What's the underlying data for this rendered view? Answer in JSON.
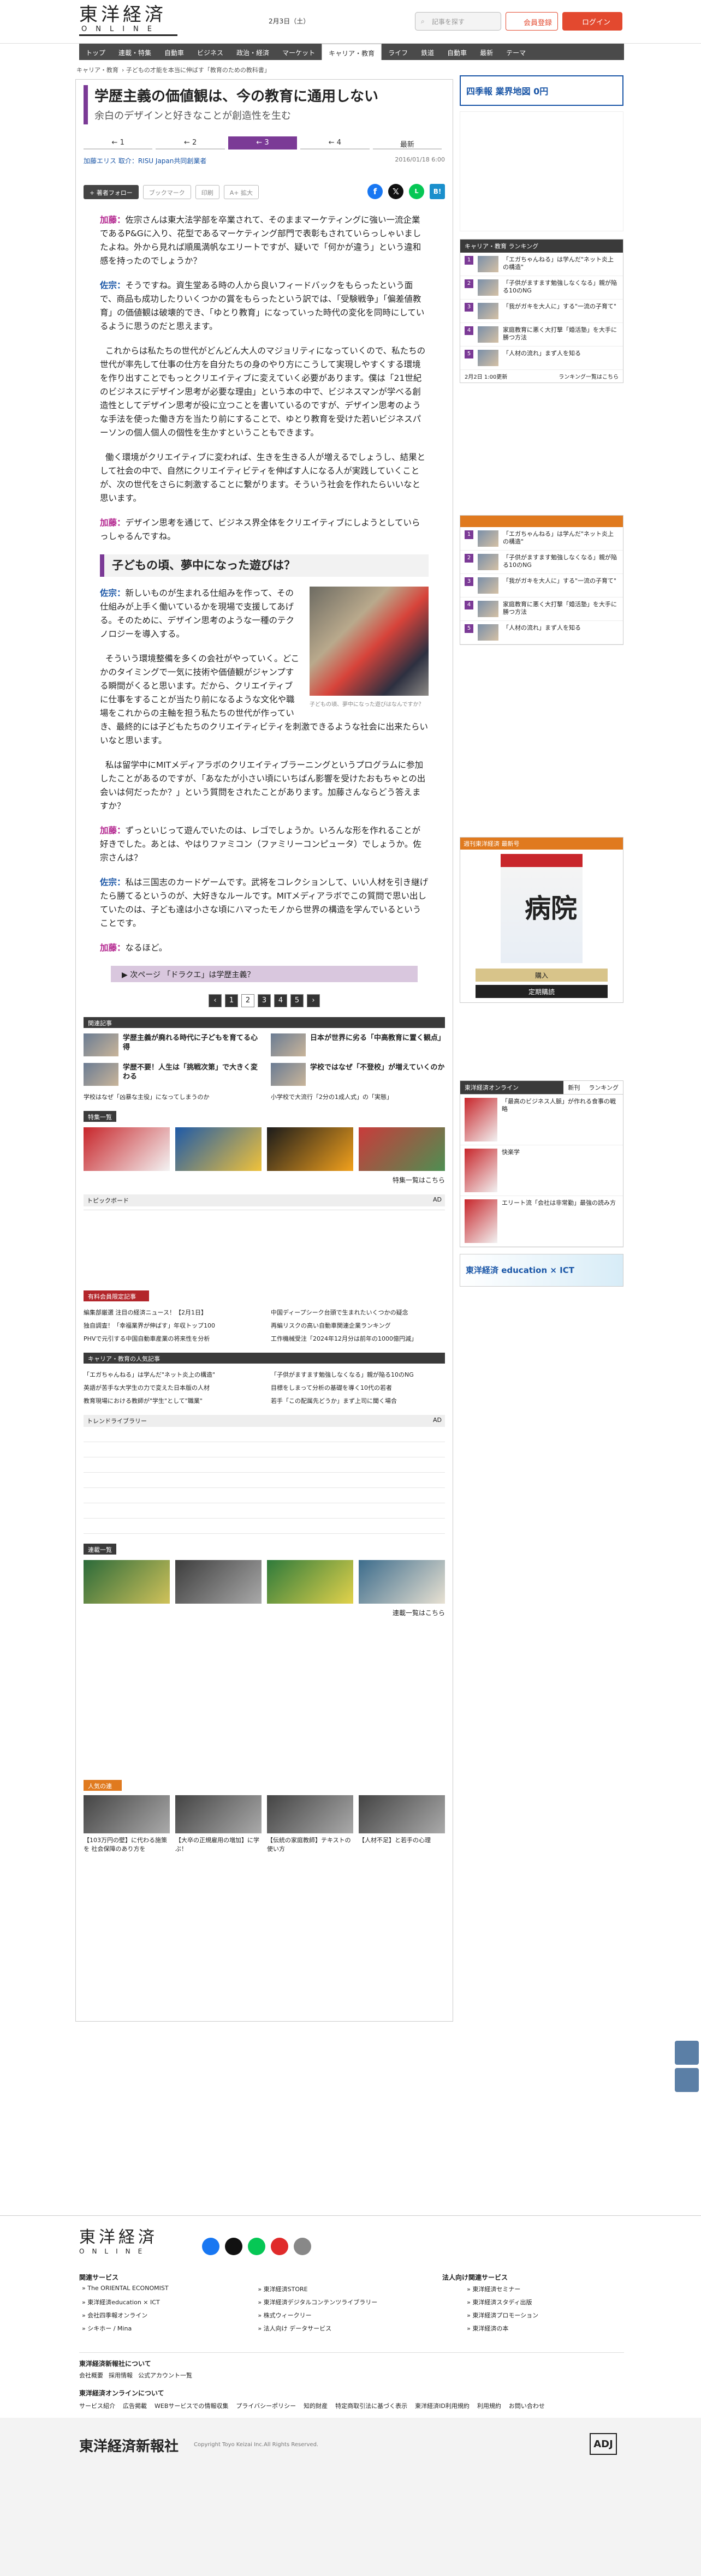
{
  "header": {
    "logo_jp": "東洋経済",
    "logo_en": "ONLINE",
    "date": "2月3日（土）",
    "search_placeholder": "記事を探す",
    "register": "会員登録",
    "login": "ログイン"
  },
  "nav": [
    "トップ",
    "連載・特集",
    "自動車",
    "ビジネス",
    "政治・経済",
    "マーケット",
    "キャリア・教育",
    "ライフ",
    "鉄道",
    "自動車",
    "最新",
    "テーマ"
  ],
  "nav_active": 6,
  "breadcrumb": [
    "キャリア・教育",
    "子どもの才能を本当に伸ばす「教育のための教科書」"
  ],
  "article": {
    "title": "学歴主義の価値観は、今の教育に通用しない",
    "subtitle": "余白のデザインと好きなことが創造性を生む",
    "page_tabs": [
      "1",
      "2",
      "3",
      "4",
      "最新"
    ],
    "current_page": 2,
    "author": "加藤エリス 取介：RISU Japan共同創業者",
    "date": "2016/01/18 6:00",
    "follow": "著者フォロー",
    "bookmark": "ブックマーク",
    "print": "印刷",
    "font": "A+ 拡大",
    "p1_speaker": "加藤：",
    "p1": "佐宗さんは東大法学部を卒業されて、そのままマーケティングに強い一流企業であるP&Gに入り、花型であるマーケティング部門で表彰もされていらっしゃいましたよね。外から見れば順風満帆なエリートですが、疑いで「何かが違う」という違和感を持ったのでしょうか？",
    "p2_speaker": "佐宗：",
    "p2": "そうですね。資生堂ある時の人から良いフィードバックをもらったという面で、商品も成功したりいくつかの賞をもらったという訳では、「受験戦争」「偏差値教育」の価値観は破壊的でき、「ゆとり教育」になっていった時代の変化を同時にしているように思うのだと思えます。",
    "p3": "これからは私たちの世代がどんどん大人のマジョリティになっていくので、私たちの世代が率先して仕事の仕方を自分たちの身のやり方にこうして実現しやすくする環境を作り出すことでもっとクリエイティブに変えていく必要があります。僕は「21世紀のビジネスにデザイン思考が必要な理由」という本の中で、ビジネスマンが学べる創造性としてデザイン思考が役に立つことを書いているのですが、デザイン思考のような手法を使った働き方を当たり前にすることで、ゆとり教育を受けた若いビジネスパーソンの個人個人の個性を生かすということもできます。",
    "p4": "働く環境がクリエイティブに変われば、生きを生きる人が増えるでしょうし、結果として社会の中で、自然にクリエイティビティを伸ばす人になる人が実践していくことが、次の世代をさらに刺激することに繋がります。そういう社会を作れたらいいなと思います。",
    "p5_speaker": "加藤：",
    "p5": "デザイン思考を通じて、ビジネス界全体をクリエイティブにしようとしていらっしゃるんですね。",
    "subhead": "子どもの頃、夢中になった遊びは？",
    "p6_speaker": "佐宗：",
    "p6": "新しいものが生まれる仕組みを作って、その仕組みが上手く働いているかを現場で支援してあげる。そのために、デザイン思考のような一種のテクノロジーを導入する。",
    "photo_caption": "子どもの頃、夢中になった遊びはなんですか？",
    "p7": "そういう環境整備を多くの会社がやっていく。どこかのタイミングで一気に技術や価値観がジャンプする瞬間がくると思います。だから、クリエイティブに仕事をすることが当たり前になるような文化や職場をこれからの主軸を担う私たちの世代が作っていき、最終的には子どもたちのクリエイティビティを刺激できるような社会に出来たらいいなと思います。",
    "p8": "私は留学中にMITメディアラボのクリエイティブラーニングというプログラムに参加したことがあるのですが、「あなたが小さい頃にいちばん影響を受けたおもちゃとの出会いは何だったか？」という質問をされたことがあります。加藤さんならどう答えますか？",
    "p9_speaker": "加藤：",
    "p9": "ずっといじって遊んでいたのは、レゴでしょうか。いろんな形を作れることが好きでした。あとは、やはりファミコン（ファミリーコンピュータ）でしょうか。佐宗さんは？",
    "p10_speaker": "佐宗：",
    "p10": "私は三国志のカードゲームです。武将をコレクションして、いい人材を引き継げたら勝てるというのが、大好きなルールです。MITメディアラボでこの質問で思い出していたのは、子ども達は小さな頃にハマったモノから世界の構造を学んでいるということです。",
    "p11_speaker": "加藤：",
    "p11": "なるほど。",
    "next": "次ページ 「ドラクエ」は学歴主義？",
    "pager": [
      "1",
      "2",
      "3",
      "4",
      "5"
    ]
  },
  "related": {
    "label": "関連記事",
    "items": [
      "学歴主義が廃れる時代に子どもを育てる心得",
      "日本が世界に劣る「中高教育に置く観点」",
      "学歴不要！人生は「挑戦次第」で大きく変わる",
      "学校ではなぜ「不登校」が増えていくのか"
    ],
    "small": [
      "学校はなぜ「凶暴な主役」になってしまうのか",
      "小学校で大流行「2分の1成人式」の「実態」"
    ]
  },
  "feature": {
    "label": "特集一覧",
    "more": "特集一覧はこちら"
  },
  "topic": {
    "label": "トピックボード",
    "ad": "AD"
  },
  "paid": {
    "label": "有料会員限定記事",
    "items": [
      "編集部厳選 注目の経済ニュース！【2月1日】",
      "中国ディープシーク台頭で生まれたいくつかの疑念",
      "独自調査！「幸福業界が伸ばす」年収トップ100",
      "再編リスクの高い自動車関連企業ランキング",
      "PHVで元引する中国自動車産業の将来性を分析",
      "工作機械受注「2024年12月分は前年の1000億円減」"
    ]
  },
  "career": {
    "label": "キャリア・教育の人気記事",
    "items": [
      "「エガちゃんねる」は学んだ\"ネット炎上の構造\"",
      "「子供がますます勉強しなくなる」親が陥る10のNG",
      "英語が苦手な大学生の力で変えた日本版の人材",
      "目標をしまって分析の基礎を導く10代の若者",
      "教育現場における教師が\"学生\"として\"職業\"",
      "若手「この配属先どうか」まず上司に聞く場合"
    ]
  },
  "trend": {
    "label": "トレンドライブラリー",
    "ad": "AD"
  },
  "serial": {
    "label": "連載一覧",
    "more": "連載一覧はこちら"
  },
  "popular": {
    "label": "人気の連載",
    "items": [
      "【103万円の壁】に代わる施策を 社会保障のあり方を",
      "【大卒の正規雇用の増加】に学ぶ！",
      "【伝統の家庭教師】テキストの使い方",
      "【人材不足】と若手の心理"
    ]
  },
  "sidebar": {
    "ad1": "四季報 業界地図 0円",
    "rank_label": "キャリア・教育 ランキング",
    "rank_items": [
      "「エガちゃんねる」は学んだ\"ネット炎上の構造\"",
      "「子供がますます勉強しなくなる」親が陥る10のNG",
      "「我がガキを大人に」する\"一流の子育て\"",
      "家庭教育に悪く大打撃「婚活塾」を大手に勝つ方法",
      "「人材の流れ」まず人を知る"
    ],
    "rank_date": "2月2日 1:00更新",
    "rank_more": "ランキング一覧はこちら",
    "mag_label": "週刊東洋経済 最新号",
    "mag_title": "病院",
    "buy": "購入",
    "sub": "定期購読",
    "rank2_label": "東洋経済オンライン",
    "rank2_tabs": [
      "新刊",
      "ランキング"
    ],
    "rank2_items": [
      "「最高のビジネス人脈」が作れる食事の戦略",
      "快楽学",
      "エリート流「会社は非常勤」最強の読み方"
    ],
    "edu": "東洋経済 education × ICT"
  },
  "footer": {
    "logo_jp": "東洋経済",
    "logo_en": "ONLINE",
    "services_label": "関連サービス",
    "services": [
      "The ORIENTAL ECONOMIST",
      "東洋経済education × ICT",
      "会社四季報オンライン",
      "シキホー / Mina",
      "東洋経済STORE",
      "東洋経済デジタルコンテンツライブラリー",
      "株式ウィークリー",
      "法人向け データサービス",
      "東洋経済セミナー",
      "東洋経済スタディ出版",
      "東洋経済プロモーション",
      "東洋経済の本"
    ],
    "corp_label": "法人向け関連サービス",
    "group_label": "東洋経済新報社について",
    "group": [
      "会社概要",
      "採用情報",
      "公式アカウント一覧"
    ],
    "online_label": "東洋経済オンラインについて",
    "online": [
      "サービス紹介",
      "広告掲載",
      "WEBサービスでの情報収集",
      "プライバシーポリシー",
      "知的財産",
      "特定商取引法に基づく表示",
      "東洋経済ID利用規約",
      "利用規約",
      "お問い合わせ"
    ],
    "publisher": "東洋経済新報社",
    "copyright": "Copyright Toyo Keizai Inc.All Rights Reserved."
  }
}
